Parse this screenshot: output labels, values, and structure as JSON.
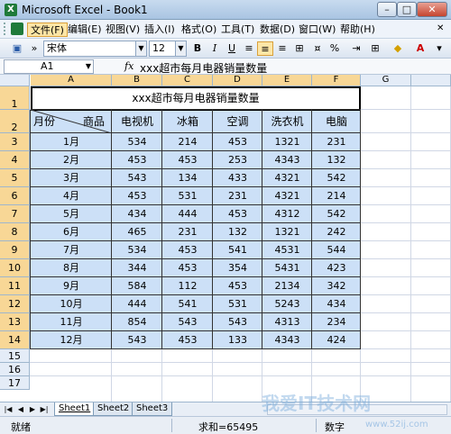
{
  "window": {
    "title": "Microsoft Excel - Book1"
  },
  "menu": [
    "文件(F)",
    "编辑(E)",
    "视图(V)",
    "插入(I)",
    "格式(O)",
    "工具(T)",
    "数据(D)",
    "窗口(W)",
    "帮助(H)"
  ],
  "toolbar": {
    "font_name": "宋体",
    "font_size": "12",
    "bold": "B",
    "italic": "I",
    "underline": "U",
    "percent": "%"
  },
  "formula_bar": {
    "name_box": "A1",
    "fx": "fx",
    "formula": "xxx超市每月电器销量数量"
  },
  "columns": [
    "A",
    "B",
    "C",
    "D",
    "E",
    "F",
    "G"
  ],
  "rows": [
    "1",
    "2",
    "3",
    "4",
    "5",
    "6",
    "7",
    "8",
    "9",
    "10",
    "11",
    "12",
    "13",
    "14",
    "15",
    "16",
    "17"
  ],
  "sheet": {
    "title": "xxx超市每月电器销量数量",
    "corner_top": "商品",
    "corner_bottom": "月份",
    "headers": [
      "电视机",
      "冰箱",
      "空调",
      "洗衣机",
      "电脑"
    ],
    "data": [
      {
        "month": "1月",
        "values": [
          "534",
          "214",
          "453",
          "1321",
          "231"
        ]
      },
      {
        "month": "2月",
        "values": [
          "453",
          "453",
          "253",
          "4343",
          "132"
        ]
      },
      {
        "month": "3月",
        "values": [
          "543",
          "134",
          "433",
          "4321",
          "542"
        ]
      },
      {
        "month": "4月",
        "values": [
          "453",
          "531",
          "231",
          "4321",
          "214"
        ]
      },
      {
        "month": "5月",
        "values": [
          "434",
          "444",
          "453",
          "4312",
          "542"
        ]
      },
      {
        "month": "6月",
        "values": [
          "465",
          "231",
          "132",
          "1321",
          "242"
        ]
      },
      {
        "month": "7月",
        "values": [
          "534",
          "453",
          "541",
          "4531",
          "544"
        ]
      },
      {
        "month": "8月",
        "values": [
          "344",
          "453",
          "354",
          "5431",
          "423"
        ]
      },
      {
        "month": "9月",
        "values": [
          "584",
          "112",
          "453",
          "2134",
          "342"
        ]
      },
      {
        "month": "10月",
        "values": [
          "444",
          "541",
          "531",
          "5243",
          "434"
        ]
      },
      {
        "month": "11月",
        "values": [
          "854",
          "543",
          "543",
          "4313",
          "234"
        ]
      },
      {
        "month": "12月",
        "values": [
          "543",
          "453",
          "133",
          "4343",
          "424"
        ]
      }
    ]
  },
  "tabs": [
    "Sheet1",
    "Sheet2",
    "Sheet3"
  ],
  "status": {
    "ready": "就绪",
    "sum": "求和=65495",
    "num": "数字"
  },
  "watermark": {
    "main": "我爱IT技术网",
    "url": "www.52ij.com"
  }
}
